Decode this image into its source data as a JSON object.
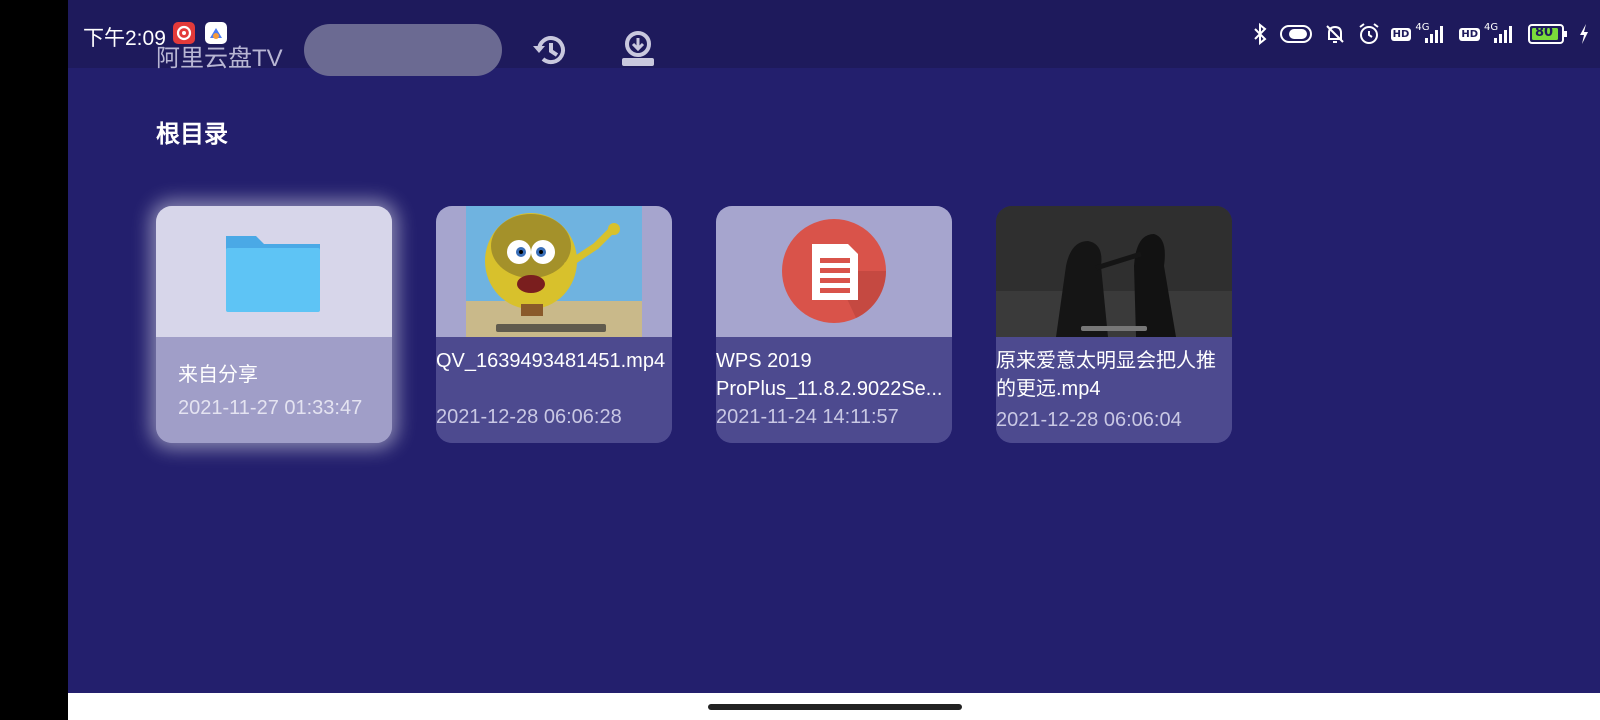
{
  "status_bar": {
    "time": "下午2:09",
    "battery": "80",
    "net1": "4G",
    "net2": "4G",
    "hd1": "HD",
    "hd2": "HD"
  },
  "header": {
    "app_title": "阿里云盘TV",
    "search_placeholder": "",
    "history_icon": "history-icon",
    "download_icon": "download-icon"
  },
  "breadcrumb": {
    "title": "根目录"
  },
  "files": [
    {
      "name": "来自分享",
      "date": "2021-11-27 01:33:47",
      "type": "folder",
      "focused": true
    },
    {
      "name": "QV_1639493481451.mp4",
      "date": "2021-12-28 06:06:28",
      "type": "video-cartoon",
      "focused": false
    },
    {
      "name": "WPS 2019 ProPlus_11.8.2.9022Se...",
      "date": "2021-11-24 14:11:57",
      "type": "document",
      "focused": false
    },
    {
      "name": "原来爱意太明显会把人推的更远.mp4",
      "date": "2021-12-28 06:06:04",
      "type": "video-dark",
      "focused": false
    }
  ],
  "colors": {
    "background": "#231f6d",
    "card_meta": "#4d4a8f",
    "folder": "#5ec4f5",
    "doc_red": "#d9534a"
  }
}
